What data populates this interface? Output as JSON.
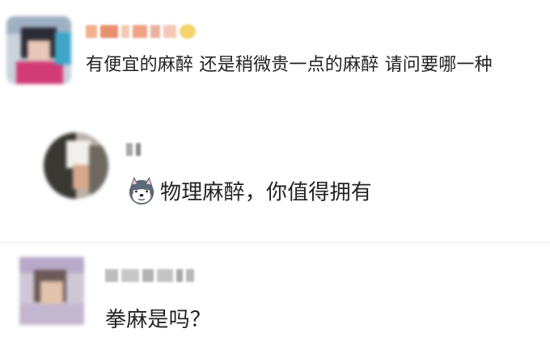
{
  "comments": [
    {
      "text": "有便宜的麻醉 还是稍微贵一点的麻醉 请问要哪一种"
    },
    {
      "emoji": "husky-dog-emoji",
      "text": "物理麻醉，你值得拥有"
    },
    {
      "text": "拳麻是吗？"
    }
  ],
  "colors": {
    "text": "#222222",
    "background": "#ffffff",
    "divider": "#eeeeee"
  }
}
